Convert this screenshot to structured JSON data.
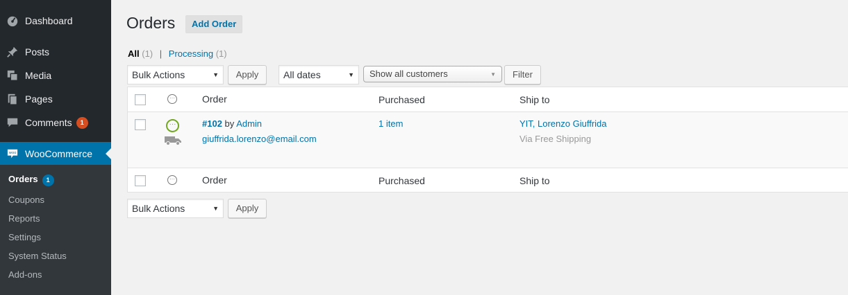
{
  "sidebar": {
    "items": [
      {
        "label": "Dashboard",
        "icon": "dashboard-icon"
      },
      {
        "label": "Posts",
        "icon": "pin-icon"
      },
      {
        "label": "Media",
        "icon": "media-icon"
      },
      {
        "label": "Pages",
        "icon": "pages-icon"
      },
      {
        "label": "Comments",
        "icon": "comment-icon",
        "badge": "1"
      },
      {
        "label": "WooCommerce",
        "icon": "woo-icon"
      }
    ],
    "submenu": [
      {
        "label": "Orders",
        "badge": "1",
        "current": true
      },
      {
        "label": "Coupons"
      },
      {
        "label": "Reports"
      },
      {
        "label": "Settings"
      },
      {
        "label": "System Status"
      },
      {
        "label": "Add-ons"
      }
    ]
  },
  "header": {
    "title": "Orders",
    "add_button": "Add Order"
  },
  "filters": {
    "all_label": "All",
    "all_count": "(1)",
    "separator": "|",
    "processing_label": "Processing",
    "processing_count": "(1)"
  },
  "toolbar": {
    "bulk_actions": "Bulk Actions",
    "apply": "Apply",
    "dates": "All dates",
    "customers": "Show all customers",
    "filter": "Filter"
  },
  "table": {
    "columns": {
      "order": "Order",
      "purchased": "Purchased",
      "ship_to": "Ship to"
    },
    "rows": [
      {
        "order_number": "#102",
        "by": "by",
        "customer": "Admin",
        "email": "giuffrida.lorenzo@email.com",
        "purchased": "1 item",
        "ship_to": "YIT, Lorenzo Giuffrida",
        "shipping_method": "Via Free Shipping"
      }
    ]
  },
  "colors": {
    "sidebar": "#23282d",
    "submenu": "#32373c",
    "accent": "#0073aa",
    "processing": "#73a724",
    "badge_red": "#d54e21"
  }
}
